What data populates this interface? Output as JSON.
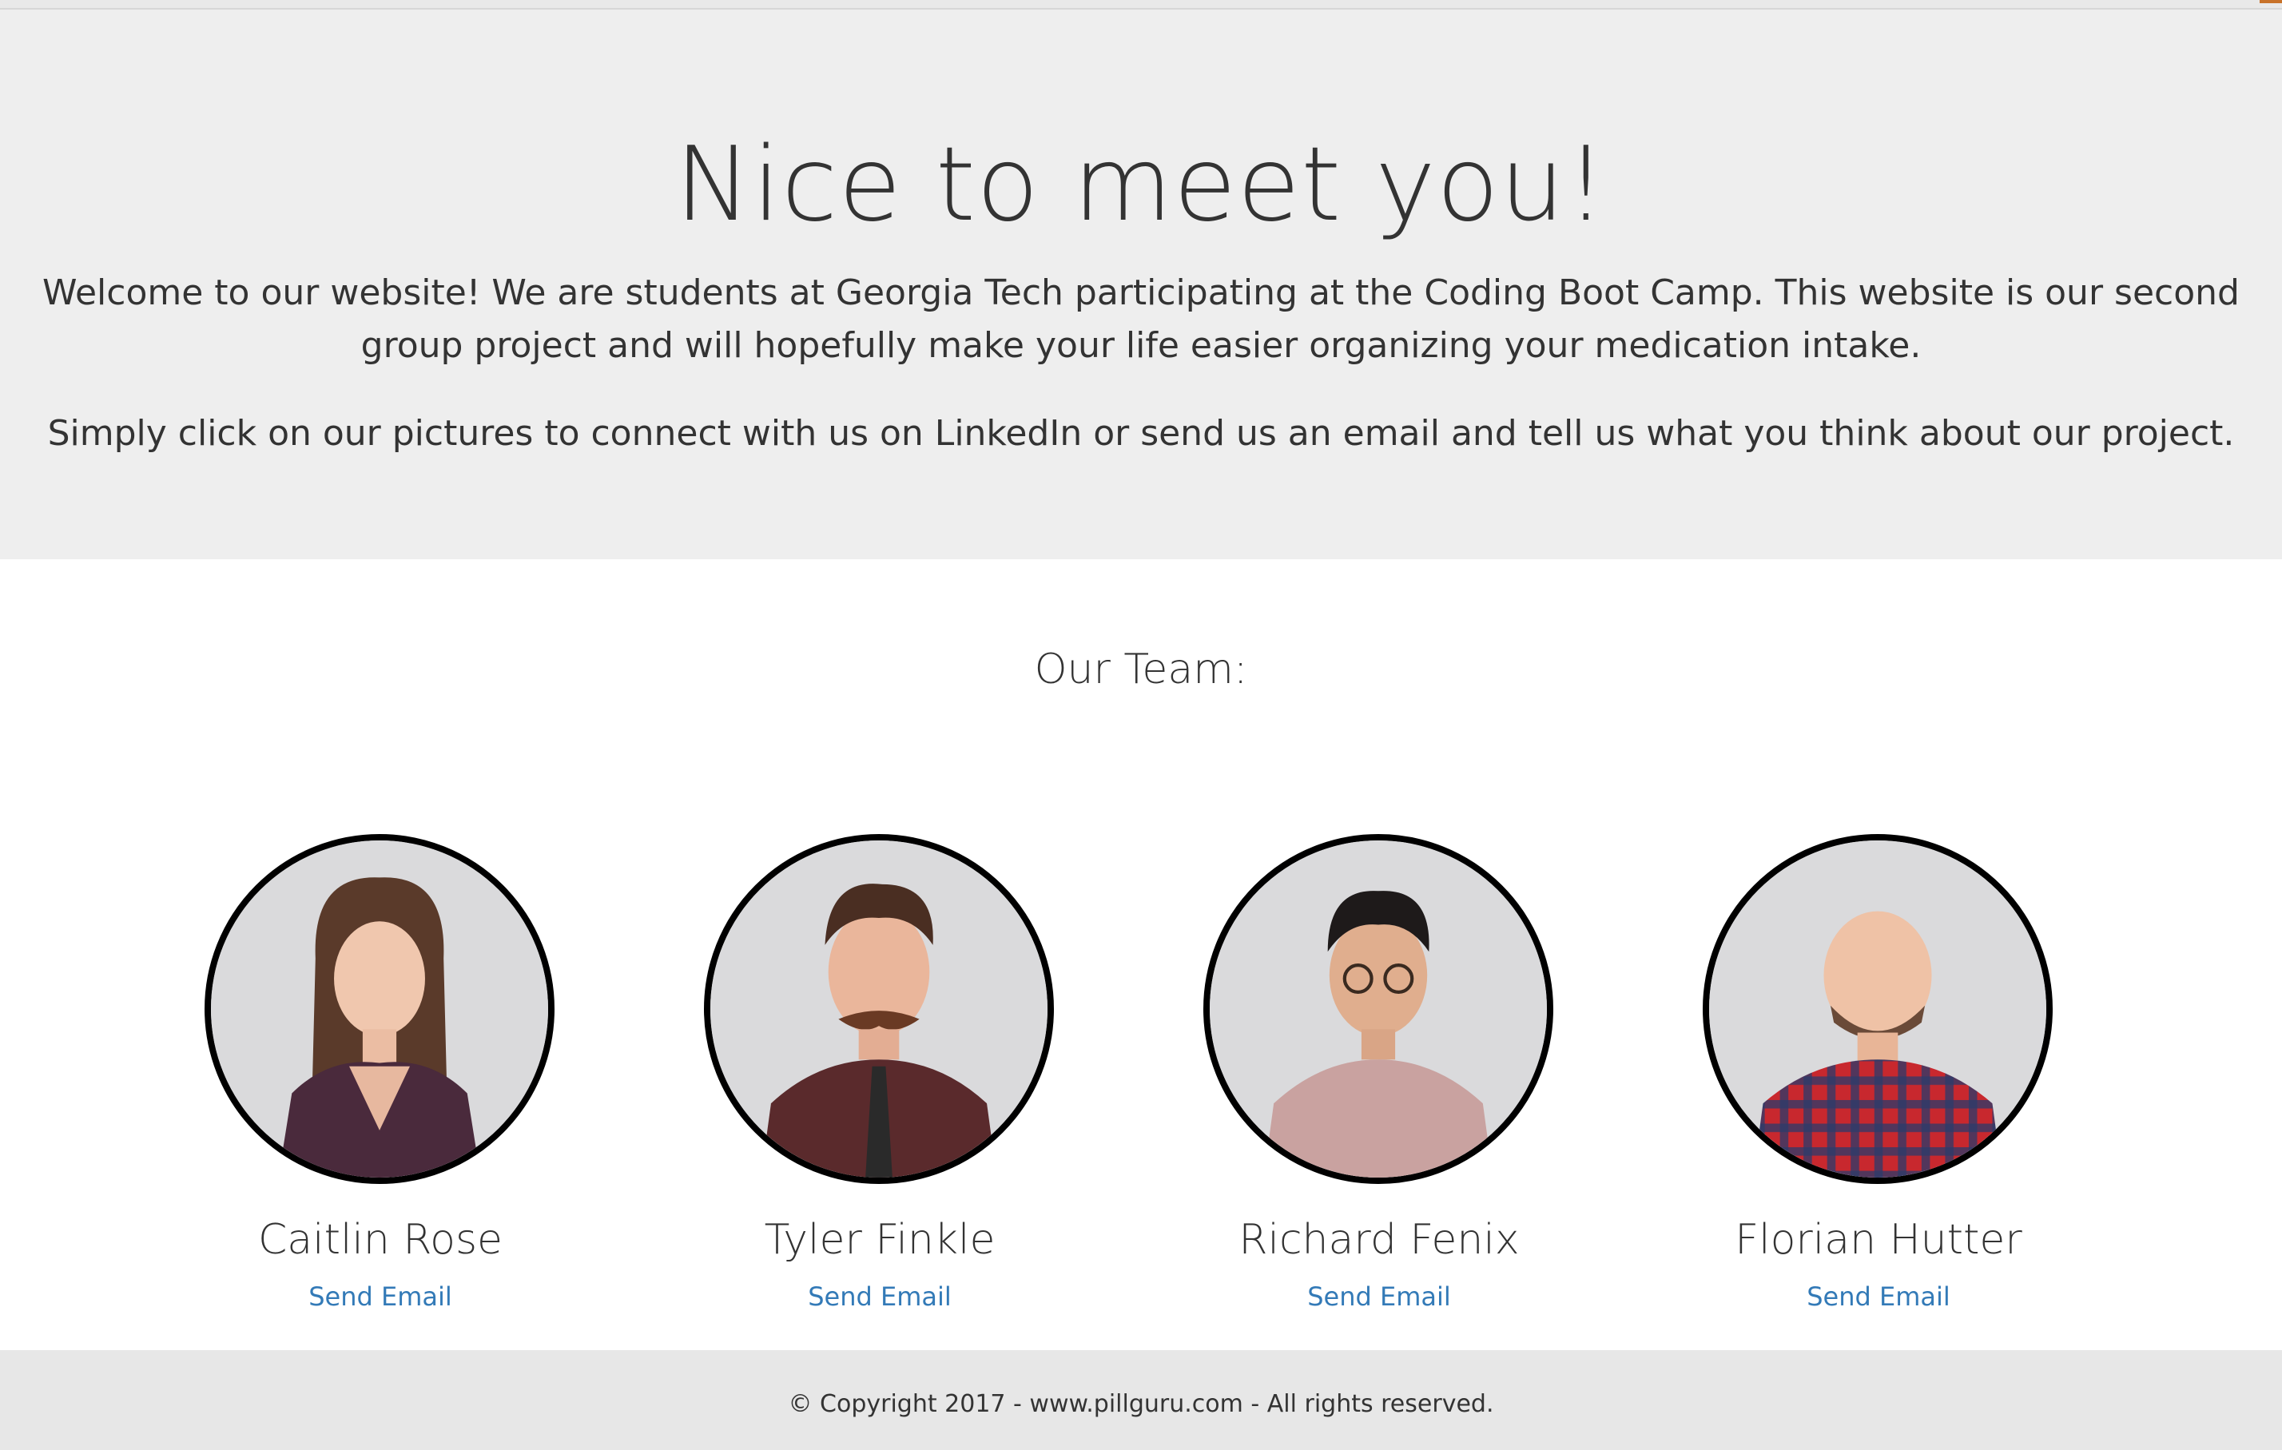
{
  "hero": {
    "title": "Nice to meet you!",
    "paragraph1": "Welcome to our website! We are students at Georgia Tech participating at the Coding Boot Camp. This website is our second group project and will hopefully make your life easier organizing your medication intake.",
    "paragraph2": "Simply click on our pictures to connect with us on LinkedIn or send us an email and tell us what you think about our project."
  },
  "team": {
    "heading": "Our Team:",
    "members": [
      {
        "name": "Caitlin Rose",
        "email_label": "Send Email"
      },
      {
        "name": "Tyler Finkle",
        "email_label": "Send Email"
      },
      {
        "name": "Richard Fenix",
        "email_label": "Send Email"
      },
      {
        "name": "Florian Hutter",
        "email_label": "Send Email"
      }
    ]
  },
  "footer": {
    "text": "© Copyright 2017 - www.pillguru.com - All rights reserved."
  },
  "colors": {
    "jumbotron_bg": "#eeeeee",
    "footer_bg": "#e7e7e7",
    "link": "#337ab7",
    "text": "#333333",
    "photo_border": "#000000"
  }
}
